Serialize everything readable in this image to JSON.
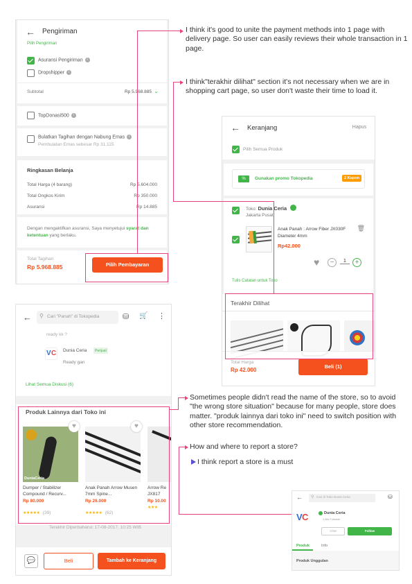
{
  "checkout": {
    "title": "Pengiriman",
    "cut_label": "Pilih Pengiriman",
    "insurance_label": "Asuransi Pengiriman",
    "dropship_label": "Dropshipper",
    "subtotal_label": "Subtotal",
    "subtotal_value": "Rp 5.968.885",
    "donation_label": "TopDonasi500",
    "gold_label": "Bulatkan Tagihan dengan Nabung Emas",
    "gold_sub": "Pembulatan Emas sebesar Rp 31.115",
    "summary_title": "Ringkasan Belanja",
    "summary_rows": [
      {
        "label": "Total Harga (4 barang)",
        "value": "Rp 5.604.000"
      },
      {
        "label": "Total Ongkos Kirim",
        "value": "Rp 350.000"
      },
      {
        "label": "Asuransi",
        "value": "Rp 14.885"
      }
    ],
    "terms_text": "Dengan mengaktifkan asuransi, Saya menyetujui",
    "terms_link": "syarat dan ketentuan",
    "terms_end": "yang berlaku.",
    "total_label": "Total Tagihan",
    "total_value": "Rp 5.968.885",
    "pay_button": "Pilih Pembayaran"
  },
  "cart": {
    "title": "Keranjang",
    "delete_label": "Hapus",
    "select_all": "Pilih Semua Produk",
    "promo_label": "Gunakan promo Tokopedia",
    "promo_badge": "2 Kupon",
    "shop_prefix": "Toko:",
    "shop_name": "Dunia Ceria",
    "shop_city": "Jakarta Pusat",
    "product_name": "Anak Panah : Arrow Fiber JX030F Diameter 4mm",
    "product_price": "Rp42.000",
    "qty": "1",
    "note_link": "Tulis Catatan untuk Toko",
    "recent_title": "Terakhir Dilihat",
    "total_label": "Total Harga",
    "total_value": "Rp 42.000",
    "buy_button": "Beli (1)"
  },
  "product": {
    "search_placeholder": "Cari \"Panah\" di Tokopedia",
    "comment_tail": "ready kk ?",
    "seller_name": "Dunia Ceria",
    "seller_badge": "Penjual",
    "seller_reply": "Ready gan",
    "all_discussion": "Lihat Semua Diskusi (6)",
    "other_title": "Produk Lainnya dari Toko ini",
    "items": [
      {
        "name": "Dumper / Stabilizer Compound / Recurv...",
        "price": "Rp 80.000",
        "rating": "(39)",
        "logo": "DuniaCeria"
      },
      {
        "name": "Anak Panah Arrow Musen 7mm Spine...",
        "price": "Rp 26.000",
        "rating": "(62)"
      },
      {
        "name": "Arrow Re JX817",
        "price": "Rp 10.00",
        "rating": ""
      }
    ],
    "updated": "Terakhir Diperbaharui: 17-08-2017, 10:25 WIB",
    "buy_button": "Beli",
    "cart_button": "Tambah ke Keranjang"
  },
  "store": {
    "search_placeholder": "Cari di Toko Dunia Ceria",
    "name": "Dunia Ceria",
    "followers": "1,8rb Follower",
    "chat_button": "Chat",
    "follow_button": "Follow",
    "tab_product": "Produk",
    "tab_info": "Info",
    "featured": "Produk Unggulan"
  },
  "notes": {
    "n1": "I think it's good to unite the payment methods into 1 page with delivery page. So user can easily reviews their whole transaction in 1 page.",
    "n2": "I think\"terakhir dilihat\" section it's not necessary when we are in shopping cart page, so user don't waste their time to load it.",
    "n3": "Sometimes people didn't read the name of the store, so to avoid \"the wrong store situation\" because for many people, store does matter. \"produk lainnya dari toko ini\" need to switch position with other store recommendation.",
    "n4": "How and where to report a store?",
    "n5": "I think report a store is a must"
  },
  "colors": {
    "accent": "#42b549",
    "cta": "#f4511e",
    "annotation": "#e8447a",
    "bullet": "#5a4fcf"
  }
}
